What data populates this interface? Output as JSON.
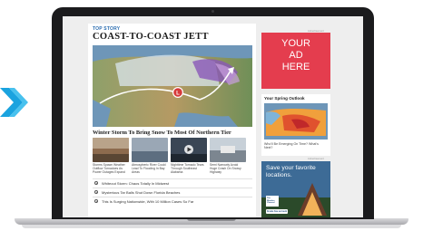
{
  "brand": {
    "accent": "#2b6db0",
    "ad_red": "#e43d4e",
    "chevron_blue": "#1aa3df"
  },
  "article": {
    "kicker": "TOP STORY",
    "headline": "COAST-TO-COAST JETT",
    "map_marker": "L",
    "caption": "Winter Storm To Bring Snow To Most Of Northern Tier"
  },
  "thumbnails": [
    {
      "text": "Storms Spawn Weather Outflow Tornadoes As Power Outages Expand",
      "icon": "storm-photo"
    },
    {
      "text": "Atmospheric River Could Lead To Flooding In Bay Areas",
      "icon": "flood-photo"
    },
    {
      "text": "Nighttime Tornado Tears Through Southeast Alabama",
      "icon": "video-play-icon"
    },
    {
      "text": "Semi Narrowly Avoid Huge Crash On Snowy Highway",
      "icon": "highway-photo"
    }
  ],
  "video_list": [
    "Whiteout Storm: Chaos Totally In Midwest",
    "Mysterious Tar Balls Shut Down Florida Beaches",
    "This Is Surging Nationwide, With 10 Million Cases So Far"
  ],
  "sidebar": {
    "ad_label": "YOUR AD HERE",
    "ad_lines": [
      "YOUR",
      "AD",
      "HERE"
    ],
    "advertisement_label": "Advertisement",
    "spring_header": "Your Spring Outlook",
    "spring_caption": "Who'll Be Emerging On Time? What's Next?",
    "promo_text": "Save your favorite locations.",
    "promo_logo": "The Weather Channel",
    "promo_button": "Create free account"
  }
}
